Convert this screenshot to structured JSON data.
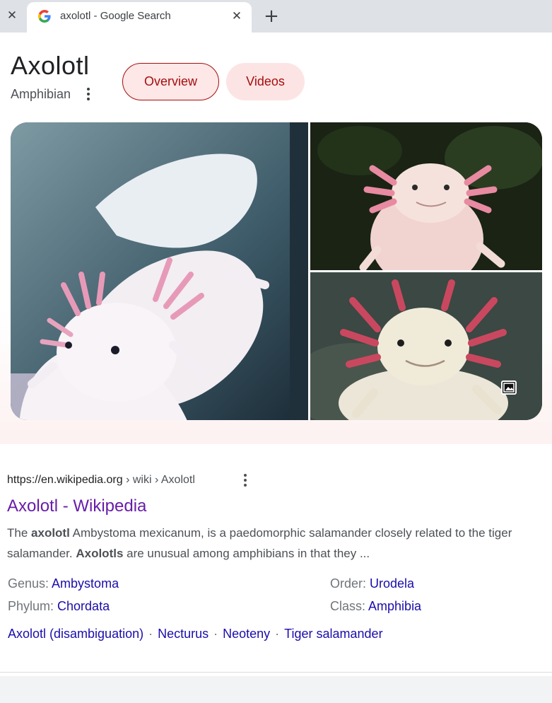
{
  "browser": {
    "tab_title": "axolotl - Google Search",
    "strip_close_glyph": "✕",
    "tab_close_glyph": "✕",
    "new_tab_glyph": "+"
  },
  "knowledge_panel": {
    "title": "Axolotl",
    "subtitle": "Amphibian",
    "chips": [
      {
        "label": "Overview",
        "selected": true
      },
      {
        "label": "Videos",
        "selected": false
      }
    ],
    "images": [
      {
        "name": "axolotl-photo-main"
      },
      {
        "name": "axolotl-photo-top-right"
      },
      {
        "name": "axolotl-photo-bottom-right"
      }
    ],
    "image_badge_icon": "image-icon"
  },
  "result": {
    "url_domain": "https://en.wikipedia.org",
    "url_crumbs": " › wiki › Axolotl",
    "title": "Axolotl - Wikipedia",
    "snippet": {
      "p1": "The ",
      "b1": "axolotl",
      "p2": " Ambystoma mexicanum, is a paedomorphic salamander closely related to the tiger salamander. ",
      "b2": "Axolotls",
      "p3": " are unusual among amphibians in that they ..."
    },
    "facts": {
      "genus": {
        "key": "Genus: ",
        "value": "Ambystoma"
      },
      "order": {
        "key": "Order: ",
        "value": "Urodela"
      },
      "phylum": {
        "key": "Phylum: ",
        "value": "Chordata"
      },
      "class": {
        "key": "Class: ",
        "value": "Amphibia"
      }
    },
    "related_links": [
      "Axolotl (disambiguation)",
      "Necturus",
      "Neoteny",
      "Tiger salamander"
    ],
    "link_separator": "·"
  },
  "colors": {
    "link": "#1a0dab",
    "visited_title": "#681da8",
    "chip_accent": "#a50e0e",
    "tabstrip": "#dee1e6"
  }
}
